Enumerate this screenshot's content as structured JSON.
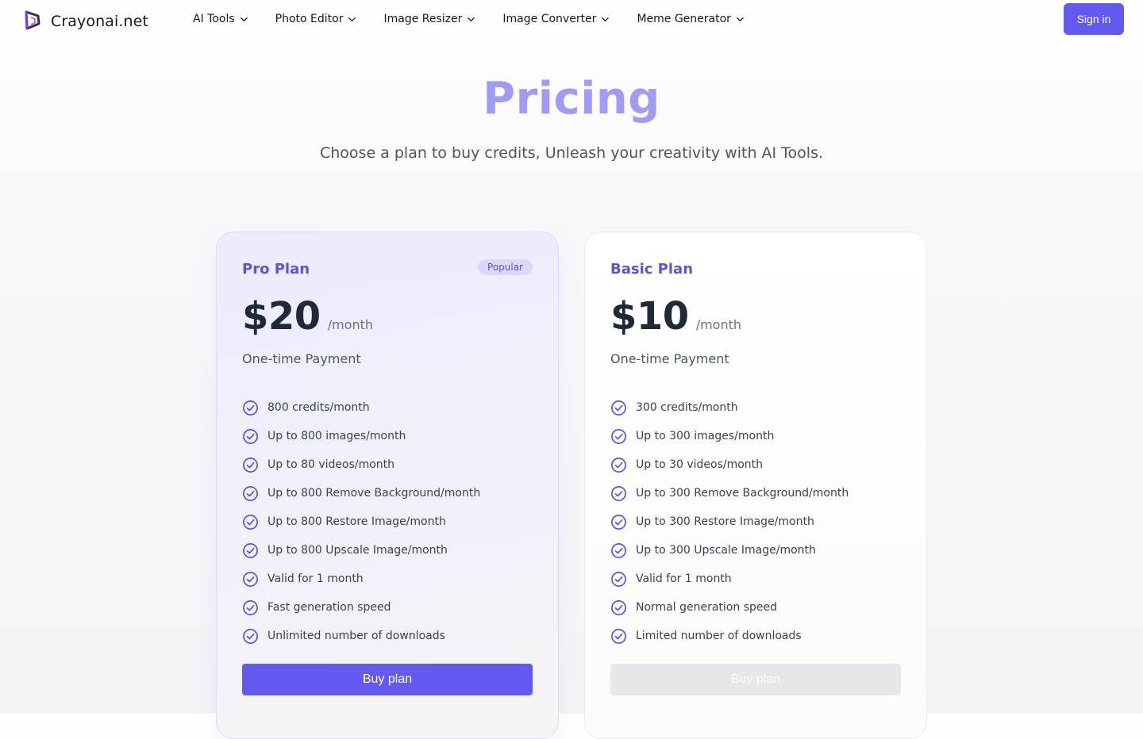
{
  "header": {
    "brand": "Crayonai.net",
    "nav": [
      {
        "label": "AI Tools"
      },
      {
        "label": "Photo Editor"
      },
      {
        "label": "Image Resizer"
      },
      {
        "label": "Image Converter"
      },
      {
        "label": "Meme Generator"
      }
    ],
    "sign_in_label": "Sign in"
  },
  "hero": {
    "title": "Pricing",
    "subtitle": "Choose a plan to buy credits, Unleash your creativity with AI Tools."
  },
  "plans": [
    {
      "name": "Pro Plan",
      "badge": "Popular",
      "price": "$20",
      "period": "/month",
      "payment_note": "One-time Payment",
      "features": [
        "800 credits/month",
        "Up to 800 images/month",
        "Up to 80 videos/month",
        "Up to 800 Remove Background/month",
        "Up to 800 Restore Image/month",
        "Up to 800 Upscale Image/month",
        "Valid for 1 month",
        "Fast generation speed",
        "Unlimited number of downloads"
      ],
      "button_label": "Buy plan",
      "button_enabled": true
    },
    {
      "name": "Basic Plan",
      "price": "$10",
      "period": "/month",
      "payment_note": "One-time Payment",
      "features": [
        "300 credits/month",
        "Up to 300 images/month",
        "Up to 30 videos/month",
        "Up to 300 Remove Background/month",
        "Up to 300 Restore Image/month",
        "Up to 300 Upscale Image/month",
        "Valid for 1 month",
        "Normal generation speed",
        "Limited number of downloads"
      ],
      "button_label": "Buy plan",
      "button_enabled": false
    }
  ],
  "colors": {
    "accent": "#6159f0",
    "title": "#a29bf5",
    "badge_bg": "#dcd9f7"
  },
  "icons": {
    "logo": "crayon-logo-icon",
    "nav_chevron": "chevron-down-icon",
    "feature_check": "check-circle-icon"
  }
}
